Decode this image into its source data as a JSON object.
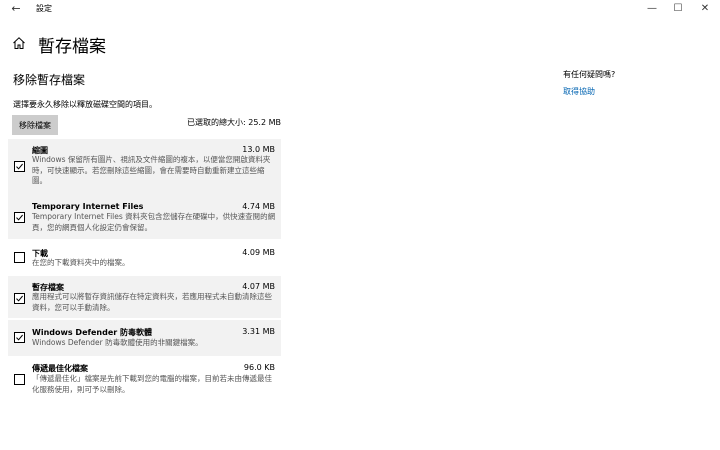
{
  "window": {
    "title": "設定",
    "back_glyph": "←",
    "minimize_glyph": "—",
    "maximize_glyph": "☐",
    "close_glyph": "✕"
  },
  "page": {
    "title": "暫存檔案",
    "section_title": "移除暫存檔案",
    "instruction": "選擇要永久移除以釋放磁碟空間的項目。",
    "remove_button": "移除檔案",
    "total_label": "已選取的總大小: 25.2 MB"
  },
  "items": [
    {
      "name": "縮圖",
      "size": "13.0 MB",
      "checked": true,
      "desc": "Windows 保留所有圖片、視訊及文件縮圖的複本，以便當您開啟資料夾時，可快速顯示。若您刪除這些縮圖，會在需要時自動重新建立這些縮圖。"
    },
    {
      "name": "Temporary Internet Files",
      "size": "4.74 MB",
      "checked": true,
      "desc": "Temporary Internet Files 資料夾包含您儲存在硬碟中，供快速查閱的網頁，您的網頁個人化設定仍會保留。"
    },
    {
      "name": "下載",
      "size": "4.09 MB",
      "checked": false,
      "desc": "在您的下載資料夾中的檔案。"
    },
    {
      "name": "暫存檔案",
      "size": "4.07 MB",
      "checked": true,
      "desc": "應用程式可以將暫存資訊儲存在特定資料夾，若應用程式未自動清除這些資料，您可以手動清除。"
    },
    {
      "name": "Windows Defender 防毒軟體",
      "size": "3.31 MB",
      "checked": true,
      "desc": "Windows Defender 防毒軟體使用的非關鍵檔案。"
    },
    {
      "name": "傳遞最佳化檔案",
      "size": "96.0 KB",
      "checked": false,
      "desc": "「傳遞最佳化」檔案是先前下載到您的電腦的檔案，目前若未由傳遞最佳化服務使用，則可予以刪除。"
    }
  ],
  "help": {
    "question": "有任何疑問嗎?",
    "link": "取得協助"
  },
  "colors": {
    "accent_link": "#0063b1",
    "selected_row_bg": "#f2f2f2",
    "button_bg": "#cccccc"
  }
}
